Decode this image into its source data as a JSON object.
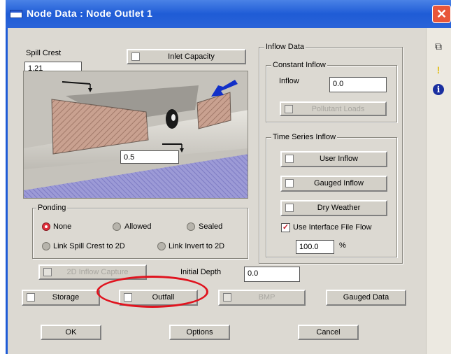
{
  "window": {
    "title": "Node Data : Node Outlet 1",
    "close_glyph": "✕"
  },
  "spill_crest": {
    "label": "Spill Crest",
    "value": "1.21"
  },
  "inlet_capacity": {
    "label": "Inlet Capacity"
  },
  "diagram": {
    "lower_value": "0.5"
  },
  "inflow_data": {
    "label": "Inflow Data",
    "constant_inflow": {
      "label": "Constant Inflow",
      "inflow_label": "Inflow",
      "inflow_value": "0.0",
      "pollutant_loads_label": "Pollutant Loads"
    },
    "time_series": {
      "label": "Time Series Inflow",
      "user_inflow": "User Inflow",
      "gauged_inflow": "Gauged Inflow",
      "dry_weather": "Dry Weather",
      "use_interface": "Use Interface File Flow",
      "percent_value": "100.0",
      "percent_unit": "%"
    }
  },
  "ponding": {
    "label": "Ponding",
    "none": "None",
    "allowed": "Allowed",
    "sealed": "Sealed",
    "link_spill": "Link Spill Crest to 2D",
    "link_invert": "Link Invert to 2D"
  },
  "outflow_capture_label": "2D Inflow Capture",
  "initial_depth": {
    "label": "Initial Depth",
    "value": "0.0"
  },
  "buttons": {
    "storage": "Storage",
    "outfall": "Outfall",
    "bmp": "BMP",
    "gauged_data": "Gauged Data",
    "ok": "OK",
    "options": "Options",
    "cancel": "Cancel"
  },
  "side_icons": {
    "copy": "⧉",
    "hint": "!",
    "info": "i"
  },
  "colors": {
    "title_blue": "#1f5cd6",
    "highlight_red": "#e0131e",
    "arrow_blue": "#1230c8"
  }
}
